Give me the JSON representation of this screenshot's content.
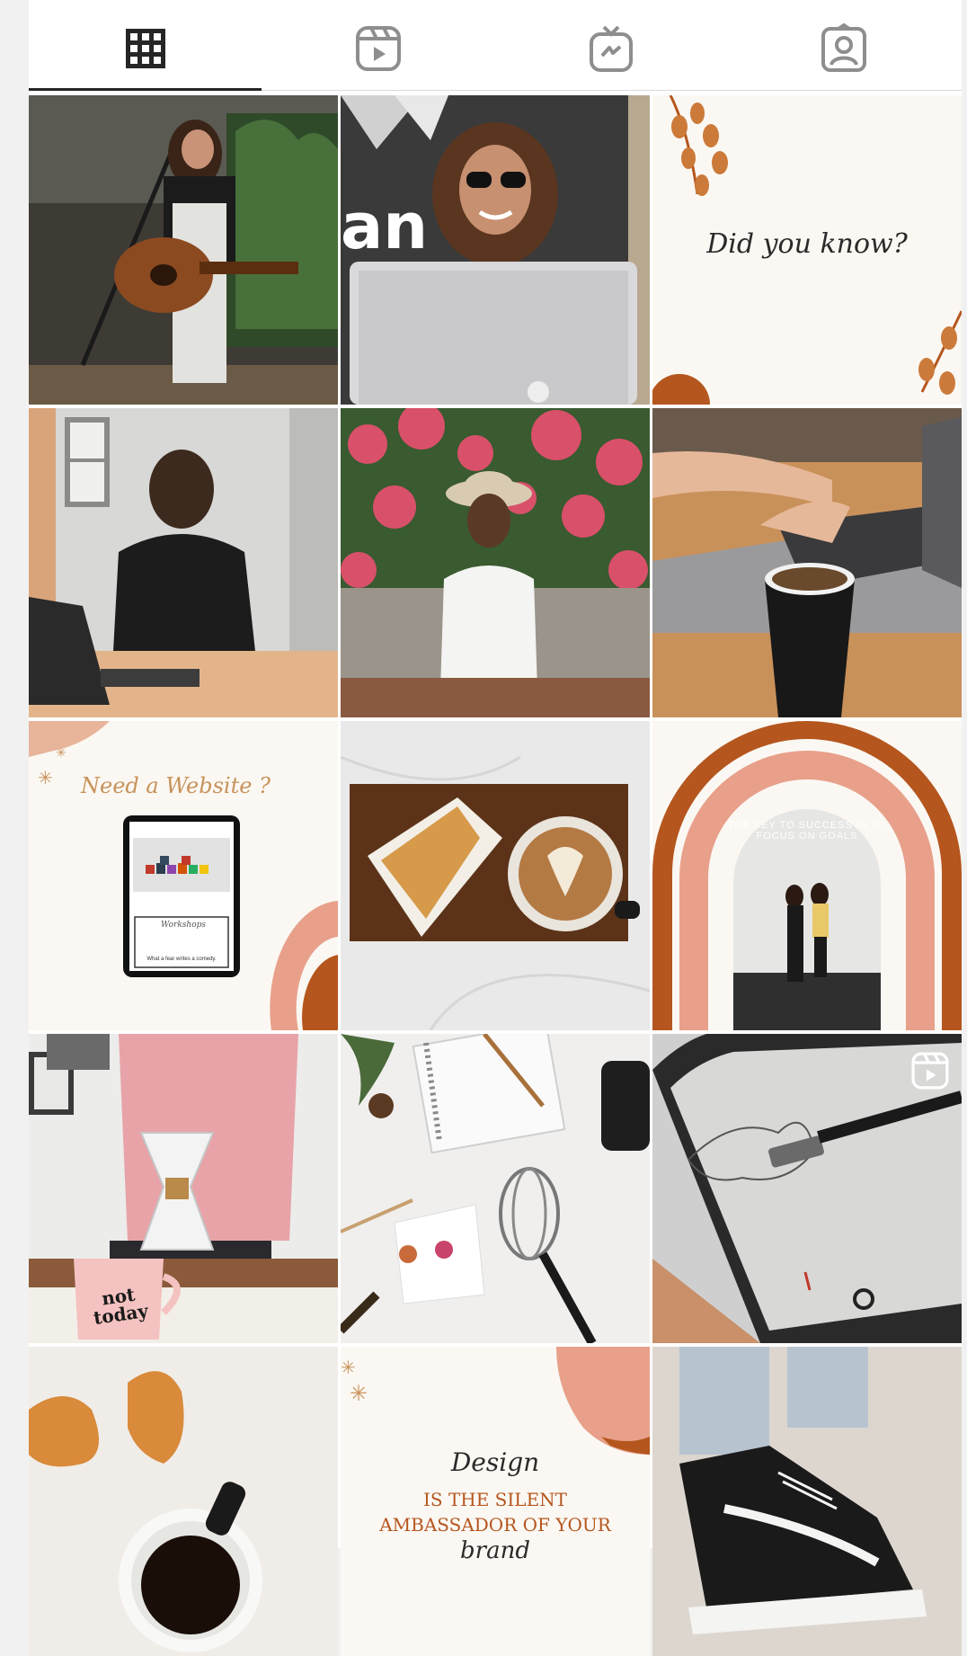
{
  "tabs": [
    {
      "id": "posts",
      "icon": "grid-icon",
      "active": true
    },
    {
      "id": "reels",
      "icon": "reels-icon",
      "active": false
    },
    {
      "id": "igtv",
      "icon": "igtv-icon",
      "active": false
    },
    {
      "id": "tagged",
      "icon": "tagged-icon",
      "active": false
    }
  ],
  "colors": {
    "active_icon": "#262626",
    "inactive_icon": "#8e8e8e",
    "terracotta": "#b5561e",
    "peach": "#e8a08a",
    "cream": "#fbf8f3"
  },
  "posts": [
    {
      "id": "post-1",
      "subject": "musician with guitar and mic"
    },
    {
      "id": "post-2",
      "subject": "woman with sunglasses behind laptop"
    },
    {
      "id": "post-3",
      "subject": "did you know graphic",
      "caption": "Did you know?"
    },
    {
      "id": "post-4",
      "subject": "man at desk with tablet"
    },
    {
      "id": "post-5",
      "subject": "woman in hat by flowers"
    },
    {
      "id": "post-6",
      "subject": "hands typing on laptop with coffee"
    },
    {
      "id": "post-7",
      "subject": "need a website graphic",
      "caption": "Need a Website ?",
      "screen_heading": "Workshops",
      "screen_line": "What a fear writes a comedy."
    },
    {
      "id": "post-8",
      "subject": "coffee and pie flat lay"
    },
    {
      "id": "post-9",
      "subject": "key to success graphic",
      "arch_text": "THE KEY TO SUCCESS IS TO FOCUS ON GOALS"
    },
    {
      "id": "post-10",
      "subject": "pour over coffee with mug",
      "mug_text": "not today"
    },
    {
      "id": "post-11",
      "subject": "notebook and whisk flat lay"
    },
    {
      "id": "post-12",
      "subject": "stylus sketching on tablet",
      "badge": "reels-icon"
    },
    {
      "id": "post-13",
      "subject": "coffee cup top view"
    },
    {
      "id": "post-14",
      "subject": "design quote graphic",
      "script": "Design",
      "line1": "IS THE SILENT",
      "line2": "AMBASSADOR OF YOUR",
      "script2": "brand"
    },
    {
      "id": "post-15",
      "subject": "black sneakers"
    }
  ]
}
